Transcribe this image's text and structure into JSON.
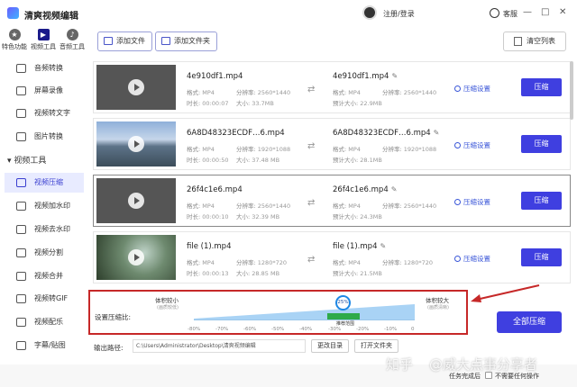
{
  "app": {
    "title": "清爽视频编辑",
    "login": "注册/登录",
    "service": "客服"
  },
  "window_controls": [
    "—",
    "□",
    "✕"
  ],
  "top_nav": [
    {
      "label": "特色功能"
    },
    {
      "label": "视频工具"
    },
    {
      "label": "音频工具"
    }
  ],
  "toolbar": {
    "add_file": "添加文件",
    "add_folder": "添加文件夹",
    "clear_list": "清空列表"
  },
  "sidebar": {
    "group_title": "视频工具",
    "items_top": [
      "音频转换",
      "屏幕录像",
      "视频转文字",
      "图片转换"
    ],
    "items": [
      "视频压缩",
      "视频加水印",
      "视频去水印",
      "视频分割",
      "视频合并",
      "视频转GIF",
      "视频配乐",
      "字幕/贴图"
    ]
  },
  "meta_labels": {
    "format": "格式:",
    "resolution": "分辨率:",
    "duration": "时长:",
    "size": "大小:",
    "est_size": "预计大小:"
  },
  "files": [
    {
      "name": "4e910df1.mp4",
      "format": "MP4",
      "resolution": "2560*1440",
      "duration": "00:00:07",
      "size": "33.7MB",
      "out_name": "4e910df1.mp4",
      "out_format": "MP4",
      "out_resolution": "2560*1440",
      "out_size": "22.9MB"
    },
    {
      "name": "6A8D48323ECDF…6.mp4",
      "format": "MP4",
      "resolution": "1920*1088",
      "duration": "00:00:50",
      "size": "37.48 MB",
      "out_name": "6A8D48323ECDF…6.mp4",
      "out_format": "MP4",
      "out_resolution": "1920*1088",
      "out_size": "28.1MB"
    },
    {
      "name": "26f4c1e6.mp4",
      "format": "MP4",
      "resolution": "2560*1440",
      "duration": "00:00:10",
      "size": "32.39 MB",
      "out_name": "26f4c1e6.mp4",
      "out_format": "MP4",
      "out_resolution": "2560*1440",
      "out_size": "24.3MB"
    },
    {
      "name": "file (1).mp4",
      "format": "MP4",
      "resolution": "1280*720",
      "duration": "00:00:13",
      "size": "28.85 MB",
      "out_name": "file (1).mp4",
      "out_format": "MP4",
      "out_resolution": "1280*720",
      "out_size": "21.5MB"
    }
  ],
  "row_actions": {
    "settings": "压缩设置",
    "compress": "压缩"
  },
  "compression": {
    "label": "设置压缩比:",
    "smaller": "体积较小",
    "smaller_sub": "(画质较低)",
    "larger": "体积较大",
    "larger_sub": "(画质清晰)",
    "value": "25%",
    "recommended": "推荐范围",
    "ticks": [
      "-80%",
      "-70%",
      "-60%",
      "-50%",
      "-40%",
      "-30%",
      "-20%",
      "-10%",
      "0"
    ]
  },
  "compress_all": "全部压缩",
  "output": {
    "label": "输出路径:",
    "path": "C:\\Users\\Administrator\\Desktop\\清爽视频编辑",
    "change_dir": "更改目录",
    "open_folder": "打开文件夹"
  },
  "status": {
    "done_label": "任务完成后",
    "no_action": "不需要任何操作"
  },
  "watermark": {
    "site": "知乎",
    "author": "@威大点事分享者"
  },
  "colors": {
    "accent": "#3f3fe0",
    "highlight": "#c62828",
    "recommended": "#2eaa4a"
  }
}
